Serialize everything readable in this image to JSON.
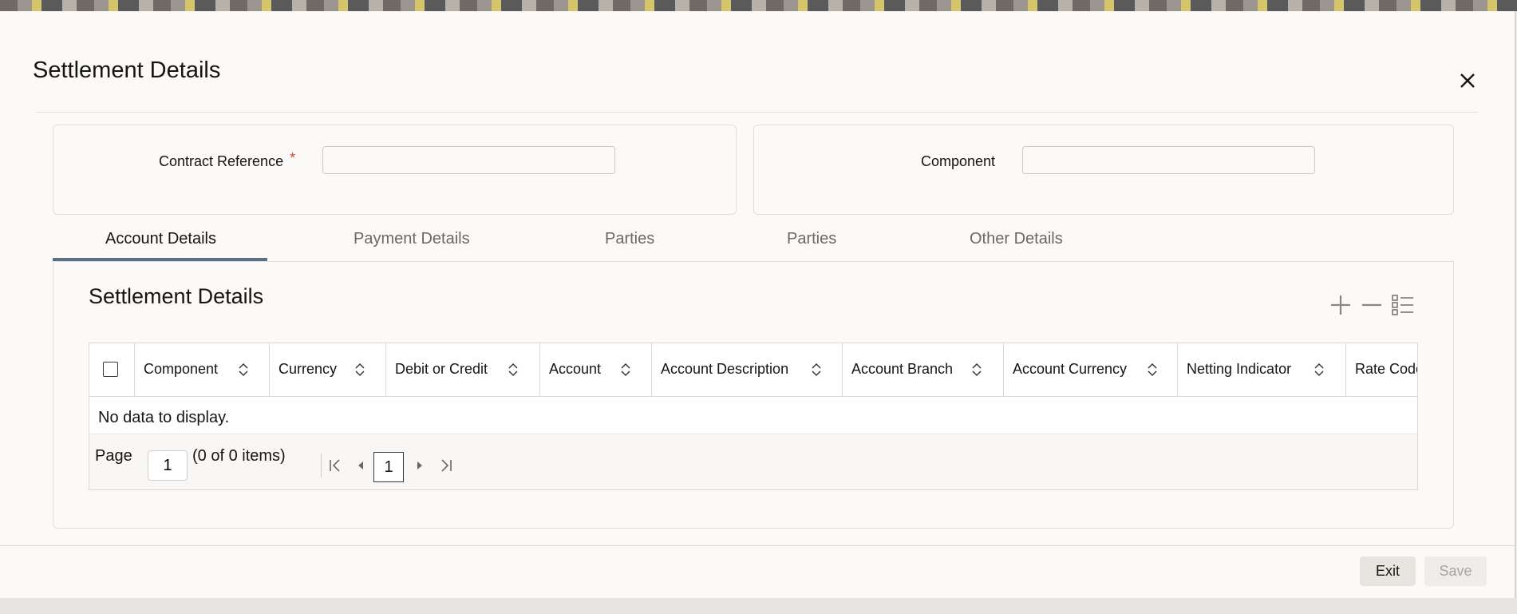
{
  "dialog": {
    "title": "Settlement Details",
    "close_icon": "close-icon"
  },
  "header_fields": {
    "contract_reference": {
      "label": "Contract Reference",
      "required_mark": "*",
      "value": ""
    },
    "component": {
      "label": "Component",
      "value": ""
    }
  },
  "tabs": [
    {
      "label": "Account Details",
      "active": true
    },
    {
      "label": "Payment Details",
      "active": false
    },
    {
      "label": "Parties",
      "active": false
    },
    {
      "label": "Parties",
      "active": false
    },
    {
      "label": "Other Details",
      "active": false
    }
  ],
  "section": {
    "title": "Settlement Details",
    "tools": [
      "add-row-icon",
      "delete-row-icon",
      "single-view-icon"
    ]
  },
  "grid": {
    "columns": [
      "Component",
      "Currency",
      "Debit or Credit",
      "Account",
      "Account Description",
      "Account Branch",
      "Account Currency",
      "Netting Indicator",
      "Rate Code"
    ],
    "empty_message": "No data to display."
  },
  "pager": {
    "page_label": "Page",
    "page_value": "1",
    "items_text": "(0 of 0 items)",
    "current_page": "1"
  },
  "footer": {
    "exit_label": "Exit",
    "save_label": "Save"
  },
  "colors": {
    "accent": "#5a7085",
    "required": "#c74634"
  }
}
